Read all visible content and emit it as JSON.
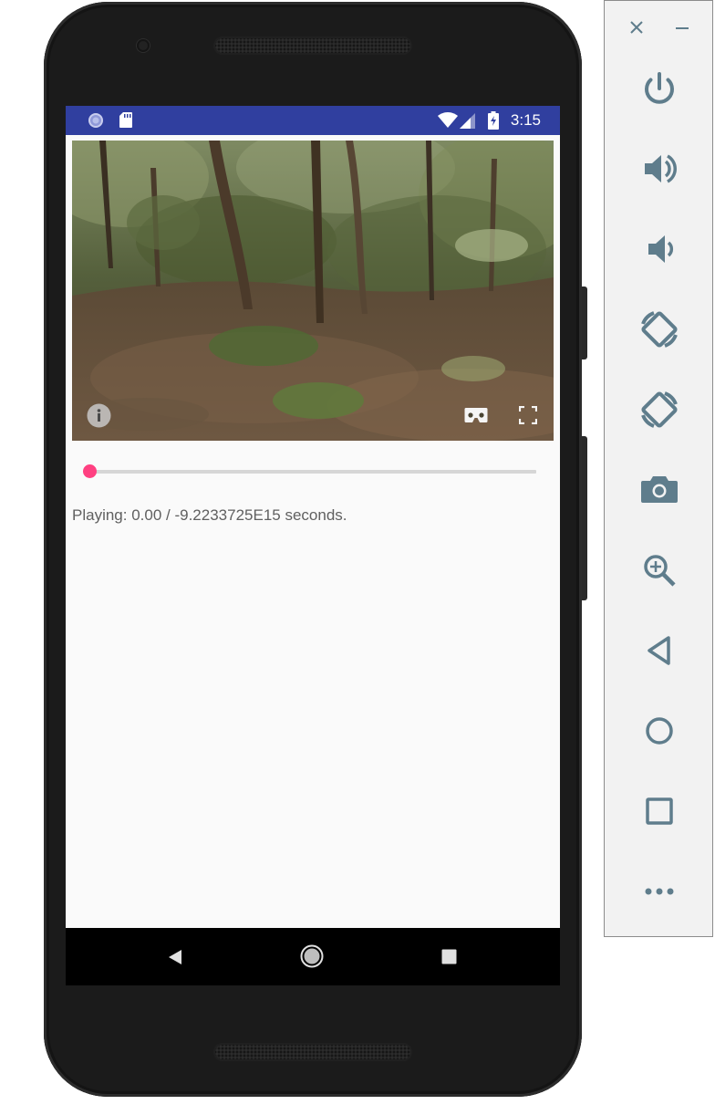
{
  "status_bar": {
    "time": "3:15",
    "color": "#303f9f"
  },
  "video": {
    "icons": [
      "info-icon",
      "cardboard-vr-icon",
      "fullscreen-icon"
    ]
  },
  "seek": {
    "progress": 0.0,
    "accent_color": "#ff4081"
  },
  "playback": {
    "status_text": "Playing: 0.00 / -9.2233725E15 seconds."
  },
  "nav_bar": {
    "icons": [
      "back-icon",
      "home-icon",
      "recents-icon"
    ]
  },
  "emulator_toolbar": {
    "window_icons": [
      "close-icon",
      "minimize-icon"
    ],
    "buttons": [
      "power-icon",
      "volume-up-icon",
      "volume-down-icon",
      "rotate-left-icon",
      "rotate-right-icon",
      "camera-icon",
      "zoom-icon",
      "back-icon",
      "home-icon",
      "overview-icon",
      "more-icon"
    ],
    "icon_color": "#5f7d8c"
  }
}
